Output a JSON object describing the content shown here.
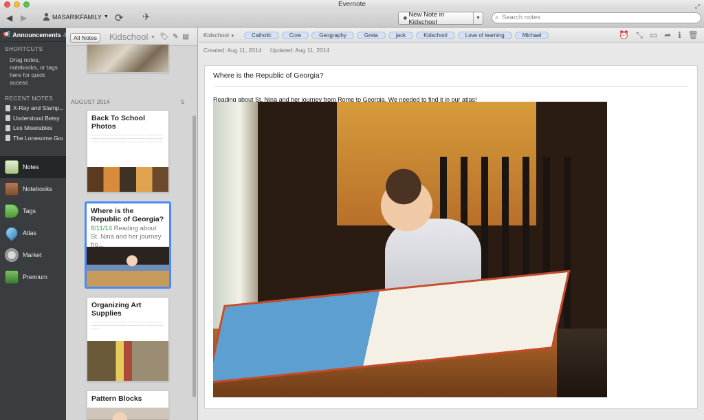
{
  "window": {
    "title": "Evernote"
  },
  "toolbar": {
    "account": "MASARIKFAMILY",
    "new_note_label": "New Note in Kidschool",
    "search_placeholder": "Search notes"
  },
  "sidebar": {
    "announcements": {
      "label": "Announcements",
      "count": "4"
    },
    "shortcuts_header": "SHORTCUTS",
    "shortcuts_hint": "Drag notes, notebooks, or tags here for quick access",
    "recent_header": "RECENT NOTES",
    "recent_notes": [
      "X-Ray and Stamp...",
      "Understood Betsy",
      "Les Miserables",
      "The Lonesome Gods"
    ],
    "items": [
      {
        "label": "Notes",
        "icon": "notes-icon"
      },
      {
        "label": "Notebooks",
        "icon": "notebooks-icon"
      },
      {
        "label": "Tags",
        "icon": "tags-icon"
      },
      {
        "label": "Atlas",
        "icon": "atlas-icon"
      },
      {
        "label": "Market",
        "icon": "market-icon"
      },
      {
        "label": "Premium",
        "icon": "premium-icon"
      }
    ]
  },
  "notelist": {
    "all_notes_label": "All Notes",
    "notebook": "Kidschool",
    "section": {
      "label": "AUGUST 2014",
      "count": "5"
    },
    "cards": [
      {
        "title": "Back To School Photos"
      },
      {
        "title": "Where is the Republic of Georgia?",
        "date": "8/11/14",
        "snippet": "Reading about St. Nina and her journey fro..."
      },
      {
        "title": "Organizing Art Supplies"
      },
      {
        "title": "Pattern Blocks"
      }
    ]
  },
  "editor": {
    "notebook": "Kidschool",
    "tags": [
      "Catholic",
      "Core",
      "Geography",
      "Greta",
      "jack",
      "Kidschool",
      "Love of learning",
      "Michael"
    ],
    "created": "Created: Aug 11, 2014",
    "updated": "Updated: Aug 11, 2014",
    "title": "Where is the Republic of Georgia?",
    "body": "Reading about St. Nina and her journey from Rome to Georgia. We needed to find it in our atlas!"
  }
}
